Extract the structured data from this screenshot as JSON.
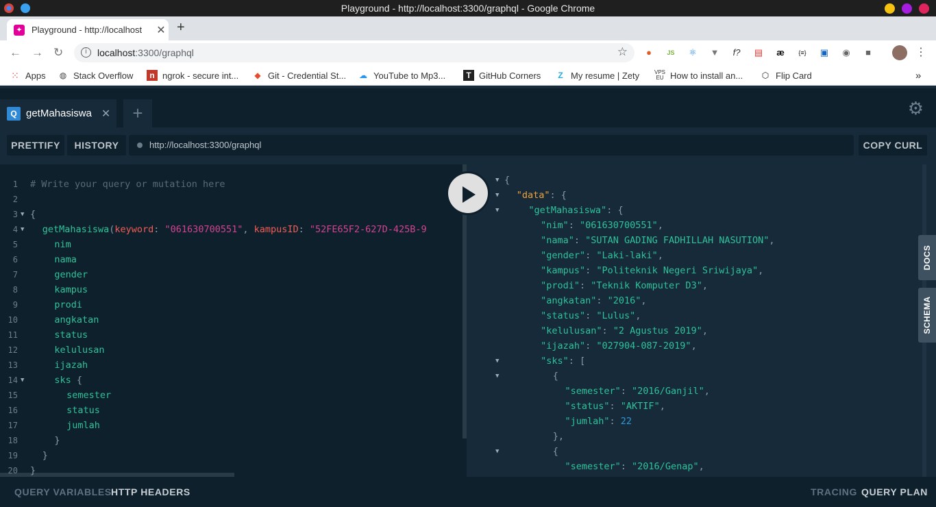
{
  "window": {
    "title": "Playground - http://localhost:3300/graphql - Google Chrome"
  },
  "browser": {
    "tab_title": "Playground - http://localhost",
    "address_host": "localhost",
    "address_path": ":3300/graphql",
    "bookmarks": [
      {
        "label": "Apps",
        "icon": "apps-grid-icon"
      },
      {
        "label": "Stack Overflow",
        "icon": "globe-icon"
      },
      {
        "label": "ngrok - secure int...",
        "icon": "ngrok-icon"
      },
      {
        "label": "Git - Credential St...",
        "icon": "git-icon"
      },
      {
        "label": "YouTube to Mp3...",
        "icon": "download-icon"
      },
      {
        "label": "GitHub Corners",
        "icon": "github-corners-icon"
      },
      {
        "label": "My resume | Zety",
        "icon": "zety-icon"
      },
      {
        "label": "How to install an...",
        "icon": "vps-icon"
      },
      {
        "label": "Flip Card",
        "icon": "codepen-icon"
      }
    ],
    "ext_glyphs": {
      "jsn": "JS",
      "f": "f?",
      "ae": "æ",
      "json": "{≡}"
    }
  },
  "playground": {
    "tab_label": "getMahasiswa",
    "tab_badge": "Q",
    "prettify": "PRETTIFY",
    "history": "HISTORY",
    "endpoint": "http://localhost:3300/graphql",
    "copy_curl": "COPY CURL",
    "docs": "DOCS",
    "schema": "SCHEMA",
    "query_variables": "QUERY VARIABLES",
    "http_headers": "HTTP HEADERS",
    "tracing": "TRACING",
    "query_plan": "QUERY PLAN",
    "query_lines": [
      {
        "n": "1",
        "fold": false,
        "indent": 0,
        "t": [
          {
            "c": "comment",
            "v": "# Write your query or mutation here"
          }
        ]
      },
      {
        "n": "2",
        "fold": false,
        "indent": 0,
        "t": []
      },
      {
        "n": "3",
        "fold": true,
        "indent": 0,
        "t": [
          {
            "c": "punc",
            "v": "{"
          }
        ]
      },
      {
        "n": "4",
        "fold": true,
        "indent": 1,
        "t": [
          {
            "c": "field",
            "v": "getMahasiswa"
          },
          {
            "c": "punc",
            "v": "("
          },
          {
            "c": "arg",
            "v": "keyword"
          },
          {
            "c": "punc",
            "v": ": "
          },
          {
            "c": "str",
            "v": "\"061630700551\""
          },
          {
            "c": "punc",
            "v": ", "
          },
          {
            "c": "arg",
            "v": "kampusID"
          },
          {
            "c": "punc",
            "v": ": "
          },
          {
            "c": "str",
            "v": "\"52FE65F2-627D-425B-9"
          }
        ]
      },
      {
        "n": "5",
        "fold": false,
        "indent": 2,
        "t": [
          {
            "c": "field",
            "v": "nim"
          }
        ]
      },
      {
        "n": "6",
        "fold": false,
        "indent": 2,
        "t": [
          {
            "c": "field",
            "v": "nama"
          }
        ]
      },
      {
        "n": "7",
        "fold": false,
        "indent": 2,
        "t": [
          {
            "c": "field",
            "v": "gender"
          }
        ]
      },
      {
        "n": "8",
        "fold": false,
        "indent": 2,
        "t": [
          {
            "c": "field",
            "v": "kampus"
          }
        ]
      },
      {
        "n": "9",
        "fold": false,
        "indent": 2,
        "t": [
          {
            "c": "field",
            "v": "prodi"
          }
        ]
      },
      {
        "n": "10",
        "fold": false,
        "indent": 2,
        "t": [
          {
            "c": "field",
            "v": "angkatan"
          }
        ]
      },
      {
        "n": "11",
        "fold": false,
        "indent": 2,
        "t": [
          {
            "c": "field",
            "v": "status"
          }
        ]
      },
      {
        "n": "12",
        "fold": false,
        "indent": 2,
        "t": [
          {
            "c": "field",
            "v": "kelulusan"
          }
        ]
      },
      {
        "n": "13",
        "fold": false,
        "indent": 2,
        "t": [
          {
            "c": "field",
            "v": "ijazah"
          }
        ]
      },
      {
        "n": "14",
        "fold": true,
        "indent": 2,
        "t": [
          {
            "c": "field",
            "v": "sks"
          },
          {
            "c": "punc",
            "v": " {"
          }
        ]
      },
      {
        "n": "15",
        "fold": false,
        "indent": 3,
        "t": [
          {
            "c": "field",
            "v": "semester"
          }
        ]
      },
      {
        "n": "16",
        "fold": false,
        "indent": 3,
        "t": [
          {
            "c": "field",
            "v": "status"
          }
        ]
      },
      {
        "n": "17",
        "fold": false,
        "indent": 3,
        "t": [
          {
            "c": "field",
            "v": "jumlah"
          }
        ]
      },
      {
        "n": "18",
        "fold": false,
        "indent": 2,
        "t": [
          {
            "c": "punc",
            "v": "}"
          }
        ]
      },
      {
        "n": "19",
        "fold": false,
        "indent": 1,
        "t": [
          {
            "c": "punc",
            "v": "}"
          }
        ]
      },
      {
        "n": "20",
        "fold": false,
        "indent": 0,
        "t": [
          {
            "c": "punc",
            "v": "}"
          }
        ]
      }
    ],
    "result_lines": [
      {
        "fold": true,
        "indent": 0,
        "t": [
          {
            "c": "punc",
            "v": "{"
          }
        ]
      },
      {
        "fold": true,
        "indent": 1,
        "t": [
          {
            "c": "topkey",
            "v": "\"data\""
          },
          {
            "c": "punc",
            "v": ": {"
          }
        ]
      },
      {
        "fold": true,
        "indent": 2,
        "t": [
          {
            "c": "key",
            "v": "\"getMahasiswa\""
          },
          {
            "c": "punc",
            "v": ": {"
          }
        ]
      },
      {
        "fold": false,
        "indent": 3,
        "t": [
          {
            "c": "key",
            "v": "\"nim\""
          },
          {
            "c": "punc",
            "v": ": "
          },
          {
            "c": "rstr",
            "v": "\"061630700551\""
          },
          {
            "c": "punc",
            "v": ","
          }
        ]
      },
      {
        "fold": false,
        "indent": 3,
        "t": [
          {
            "c": "key",
            "v": "\"nama\""
          },
          {
            "c": "punc",
            "v": ": "
          },
          {
            "c": "rstr",
            "v": "\"SUTAN GADING FADHILLAH NASUTION\""
          },
          {
            "c": "punc",
            "v": ","
          }
        ]
      },
      {
        "fold": false,
        "indent": 3,
        "t": [
          {
            "c": "key",
            "v": "\"gender\""
          },
          {
            "c": "punc",
            "v": ": "
          },
          {
            "c": "rstr",
            "v": "\"Laki-laki\""
          },
          {
            "c": "punc",
            "v": ","
          }
        ]
      },
      {
        "fold": false,
        "indent": 3,
        "t": [
          {
            "c": "key",
            "v": "\"kampus\""
          },
          {
            "c": "punc",
            "v": ": "
          },
          {
            "c": "rstr",
            "v": "\"Politeknik Negeri Sriwijaya\""
          },
          {
            "c": "punc",
            "v": ","
          }
        ]
      },
      {
        "fold": false,
        "indent": 3,
        "t": [
          {
            "c": "key",
            "v": "\"prodi\""
          },
          {
            "c": "punc",
            "v": ": "
          },
          {
            "c": "rstr",
            "v": "\"Teknik Komputer D3\""
          },
          {
            "c": "punc",
            "v": ","
          }
        ]
      },
      {
        "fold": false,
        "indent": 3,
        "t": [
          {
            "c": "key",
            "v": "\"angkatan\""
          },
          {
            "c": "punc",
            "v": ": "
          },
          {
            "c": "rstr",
            "v": "\"2016\""
          },
          {
            "c": "punc",
            "v": ","
          }
        ]
      },
      {
        "fold": false,
        "indent": 3,
        "t": [
          {
            "c": "key",
            "v": "\"status\""
          },
          {
            "c": "punc",
            "v": ": "
          },
          {
            "c": "rstr",
            "v": "\"Lulus\""
          },
          {
            "c": "punc",
            "v": ","
          }
        ]
      },
      {
        "fold": false,
        "indent": 3,
        "t": [
          {
            "c": "key",
            "v": "\"kelulusan\""
          },
          {
            "c": "punc",
            "v": ": "
          },
          {
            "c": "rstr",
            "v": "\"2 Agustus 2019\""
          },
          {
            "c": "punc",
            "v": ","
          }
        ]
      },
      {
        "fold": false,
        "indent": 3,
        "t": [
          {
            "c": "key",
            "v": "\"ijazah\""
          },
          {
            "c": "punc",
            "v": ": "
          },
          {
            "c": "rstr",
            "v": "\"027904-087-2019\""
          },
          {
            "c": "punc",
            "v": ","
          }
        ]
      },
      {
        "fold": true,
        "indent": 3,
        "t": [
          {
            "c": "key",
            "v": "\"sks\""
          },
          {
            "c": "punc",
            "v": ": ["
          }
        ]
      },
      {
        "fold": true,
        "indent": 4,
        "t": [
          {
            "c": "punc",
            "v": "{"
          }
        ]
      },
      {
        "fold": false,
        "indent": 5,
        "t": [
          {
            "c": "key",
            "v": "\"semester\""
          },
          {
            "c": "punc",
            "v": ": "
          },
          {
            "c": "rstr",
            "v": "\"2016/Ganjil\""
          },
          {
            "c": "punc",
            "v": ","
          }
        ]
      },
      {
        "fold": false,
        "indent": 5,
        "t": [
          {
            "c": "key",
            "v": "\"status\""
          },
          {
            "c": "punc",
            "v": ": "
          },
          {
            "c": "rstr",
            "v": "\"AKTIF\""
          },
          {
            "c": "punc",
            "v": ","
          }
        ]
      },
      {
        "fold": false,
        "indent": 5,
        "t": [
          {
            "c": "key",
            "v": "\"jumlah\""
          },
          {
            "c": "punc",
            "v": ": "
          },
          {
            "c": "num",
            "v": "22"
          }
        ]
      },
      {
        "fold": false,
        "indent": 4,
        "t": [
          {
            "c": "punc",
            "v": "},"
          }
        ]
      },
      {
        "fold": true,
        "indent": 4,
        "t": [
          {
            "c": "punc",
            "v": "{"
          }
        ]
      },
      {
        "fold": false,
        "indent": 5,
        "t": [
          {
            "c": "key",
            "v": "\"semester\""
          },
          {
            "c": "punc",
            "v": ": "
          },
          {
            "c": "rstr",
            "v": "\"2016/Genap\""
          },
          {
            "c": "punc",
            "v": ","
          }
        ]
      }
    ]
  }
}
